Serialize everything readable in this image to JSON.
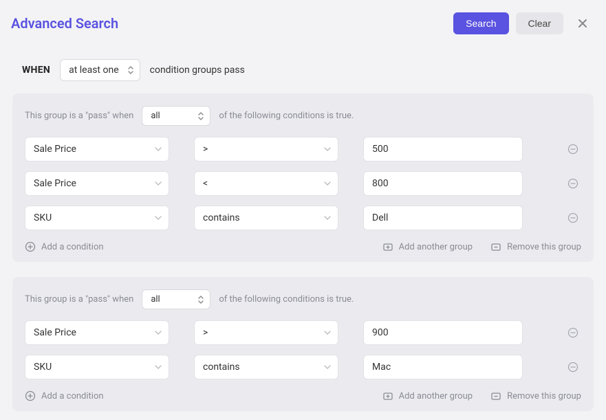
{
  "header": {
    "title": "Advanced Search",
    "search_label": "Search",
    "clear_label": "Clear"
  },
  "when": {
    "label": "WHEN",
    "selected": "at least one",
    "tail": "condition groups pass"
  },
  "group_text": {
    "prefix": "This group is a \"pass\" when",
    "suffix": "of the following conditions is true."
  },
  "actions": {
    "add_condition": "Add a condition",
    "add_group": "Add another group",
    "remove_group": "Remove this group"
  },
  "groups": [
    {
      "match": "all",
      "conditions": [
        {
          "field": "Sale Price",
          "operator": ">",
          "value": "500"
        },
        {
          "field": "Sale Price",
          "operator": "<",
          "value": "800"
        },
        {
          "field": "SKU",
          "operator": "contains",
          "value": "Dell"
        }
      ]
    },
    {
      "match": "all",
      "conditions": [
        {
          "field": "Sale Price",
          "operator": ">",
          "value": "900"
        },
        {
          "field": "SKU",
          "operator": "contains",
          "value": "Mac"
        }
      ]
    }
  ]
}
